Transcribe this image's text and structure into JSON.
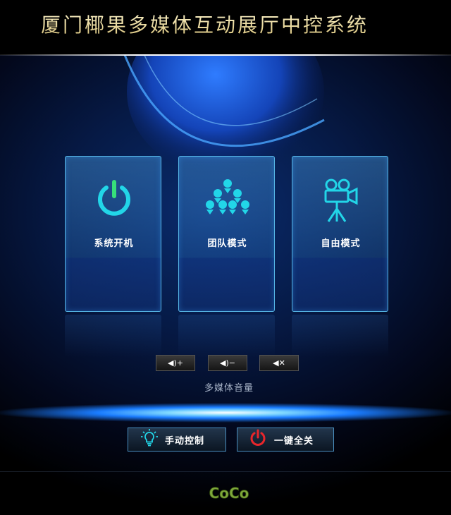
{
  "header": {
    "title": "厦门椰果多媒体互动展厅中控系统"
  },
  "modes": [
    {
      "label": "系统开机",
      "icon": "power-icon"
    },
    {
      "label": "团队模式",
      "icon": "team-icon"
    },
    {
      "label": "自由模式",
      "icon": "movie-camera-icon"
    }
  ],
  "volume": {
    "up_label": "◀)+",
    "down_label": "◀)−",
    "mute_label": "◀✕",
    "caption": "多媒体音量"
  },
  "actions": {
    "manual_label": "手动控制",
    "shutdown_label": "一键全关"
  },
  "footer": {
    "logo_text": "CoCo"
  },
  "colors": {
    "accent_cyan": "#22d6e8",
    "power_red": "#e8262b",
    "title_gold": "#f3e5a0"
  }
}
